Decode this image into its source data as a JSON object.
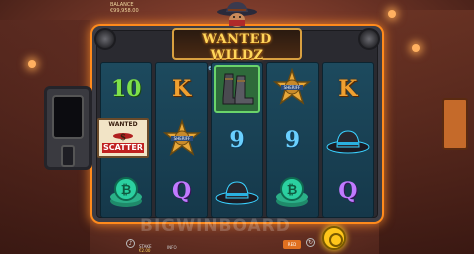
{
  "top_bar": {
    "balance_label": "BALANCE",
    "balance_value": "€99,958.00"
  },
  "logo": {
    "main": "WANTED WILDZ",
    "sub": "extreme"
  },
  "reels": [
    [
      {
        "symbol": "10",
        "kind": "text",
        "color": "green"
      },
      {
        "symbol": "scatter-poster",
        "kind": "image"
      },
      {
        "symbol": "bitcoin-coin",
        "kind": "image"
      }
    ],
    [
      {
        "symbol": "K",
        "kind": "text",
        "color": "orange"
      },
      {
        "symbol": "sheriff-badge",
        "kind": "image"
      },
      {
        "symbol": "Q",
        "kind": "text",
        "color": "purple"
      }
    ],
    [
      {
        "symbol": "boots",
        "kind": "image",
        "highlighted": true
      },
      {
        "symbol": "9",
        "kind": "text",
        "color": "blue"
      },
      {
        "symbol": "cowboy-hat-teal",
        "kind": "image"
      }
    ],
    [
      {
        "symbol": "sheriff-badge",
        "kind": "image"
      },
      {
        "symbol": "9",
        "kind": "text",
        "color": "blue"
      },
      {
        "symbol": "bitcoin-coin",
        "kind": "image"
      }
    ],
    [
      {
        "symbol": "K",
        "kind": "text",
        "color": "orange"
      },
      {
        "symbol": "cowboy-hat-teal",
        "kind": "image"
      },
      {
        "symbol": "Q",
        "kind": "text",
        "color": "purple"
      }
    ]
  ],
  "scatter": {
    "top": "WANTED",
    "bottom": "SCATTER"
  },
  "watermark": "BIGWINBOARD",
  "bottom": {
    "stake_label": "STAKE",
    "stake_value": "€2.00",
    "info": "INFO",
    "provider_badge": "RED"
  },
  "colors": {
    "frame_glow": "#ff8a1c",
    "reel_bg": "#1d4a5e",
    "spin_button": "#ffc61a"
  }
}
